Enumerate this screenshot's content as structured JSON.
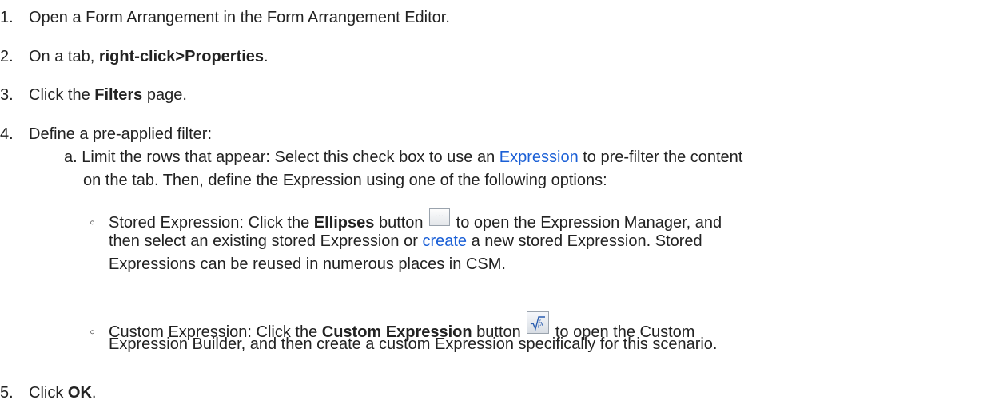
{
  "steps": {
    "s1": {
      "num": "1.",
      "text": "Open a Form Arrangement in the Form Arrangement Editor."
    },
    "s2": {
      "num": "2.",
      "pre": "On a tab, ",
      "bold": "right-click>Properties",
      "post": "."
    },
    "s3": {
      "num": "3.",
      "pre": "Click the ",
      "bold": "Filters",
      "post": " page."
    },
    "s4": {
      "num": "4.",
      "text": "Define a pre-applied filter:"
    },
    "s4a": {
      "letter": "a.",
      "line1_pre": "Limit the rows that appear: Select this check box to use an ",
      "line1_link": "Expression",
      "line1_post": " to pre-filter the content",
      "line2": "on the tab. Then, define the Expression using one of the following options:"
    },
    "stored": {
      "bullet": "◦",
      "pre": "Stored Expression: Click the ",
      "bold": "Ellipses",
      "mid": " button ",
      "post": " to open the Expression Manager, and",
      "line2_pre": "then select an existing stored Expression or ",
      "line2_link": "create",
      "line2_post": " a new stored Expression. Stored",
      "line3": "Expressions can be reused in numerous places in CSM."
    },
    "custom": {
      "bullet": "◦",
      "pre": "Custom Expression: Click the ",
      "bold": "Custom Expression",
      "mid": " button ",
      "post": " to open the Custom",
      "line2": "Expression Builder, and then create a custom Expression specifically for this scenario."
    },
    "s5": {
      "num": "5.",
      "pre": "Click ",
      "bold": "OK",
      "post": "."
    }
  },
  "icons": {
    "ellipses": "ellipses-button-icon",
    "custom_expression": "custom-expression-button-icon"
  },
  "colors": {
    "text": "#222222",
    "link": "#1a5fd6"
  }
}
